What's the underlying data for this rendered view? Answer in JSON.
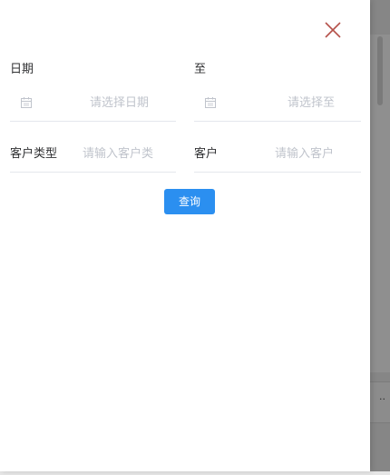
{
  "colors": {
    "accent": "#2b8ff0",
    "close_icon": "#b5524a",
    "label": "#303133",
    "placeholder": "#c0c4cc",
    "divider": "#e4e7ed"
  },
  "drawer": {
    "close_icon": "close-icon",
    "fields": {
      "date_from": {
        "label": "日期",
        "placeholder": "请选择日期",
        "icon": "calendar-icon"
      },
      "date_to": {
        "label": "至",
        "placeholder": "请选择至",
        "icon": "calendar-icon"
      },
      "customer_type": {
        "label": "客户类型",
        "placeholder": "请输入客户类"
      },
      "customer": {
        "label": "客户",
        "placeholder": "请输入客户"
      }
    },
    "query_button": "查询"
  },
  "background": {
    "more_indicator": "··"
  }
}
